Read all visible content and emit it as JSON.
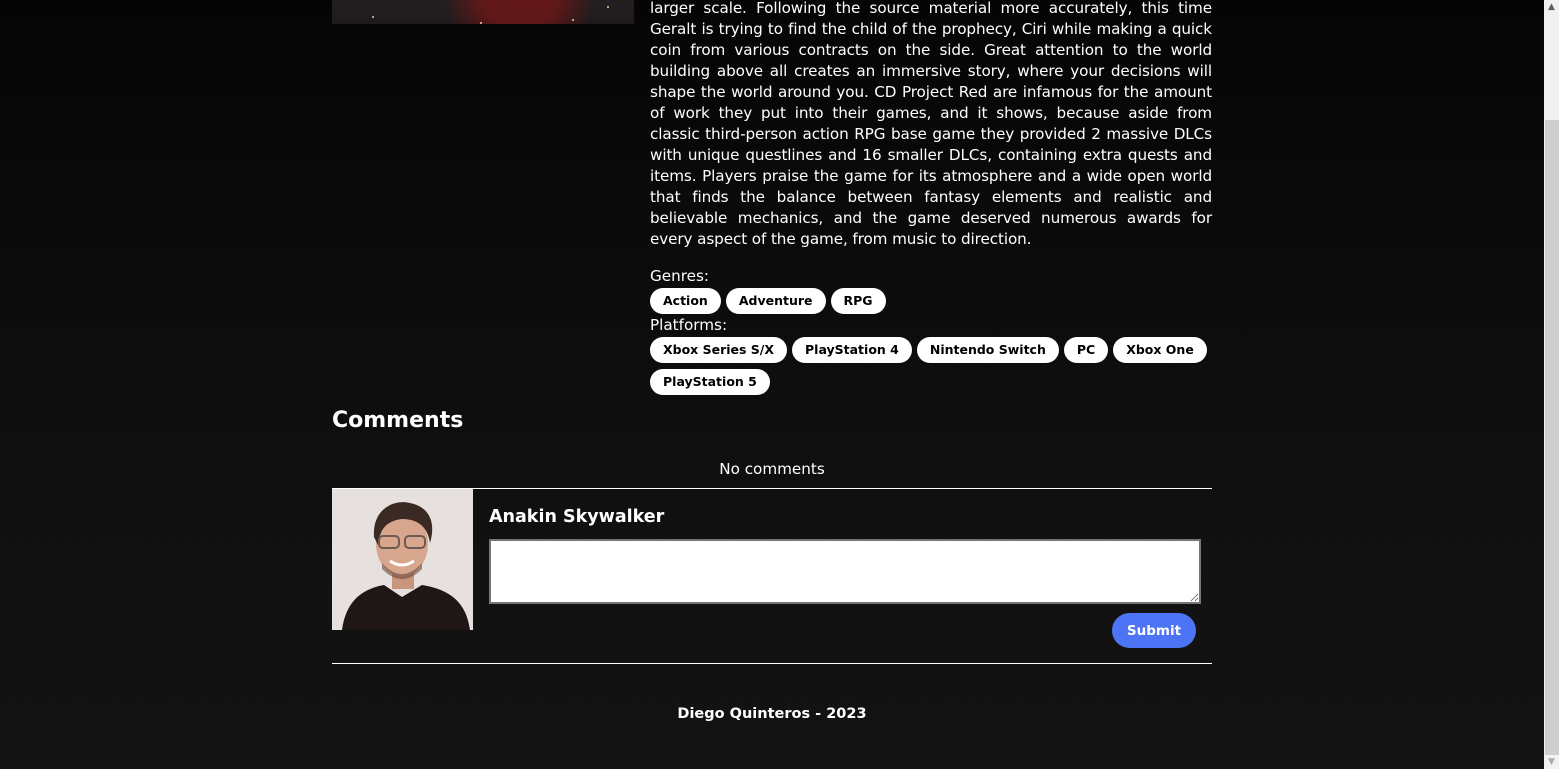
{
  "game": {
    "cover_alt": "game-cover-art",
    "description": "larger scale. Following the source material more accurately, this time Geralt is trying to find the child of the prophecy, Ciri while making a quick coin from various contracts on the side. Great attention to the world building above all creates an immersive story, where your decisions will shape the world around you. CD Project Red are infamous for the amount of work they put into their games, and it shows, because aside from classic third-person action RPG base game they provided 2 massive DLCs with unique questlines and 16 smaller DLCs, containing extra quests and items. Players praise the game for its atmosphere and a wide open world that finds the balance between fantasy elements and realistic and believable mechanics, and the game deserved numerous awards for every aspect of the game, from music to direction.",
    "genres_label": "Genres:",
    "genres": [
      "Action",
      "Adventure",
      "RPG"
    ],
    "platforms_label": "Platforms:",
    "platforms": [
      "Xbox Series S/X",
      "PlayStation 4",
      "Nintendo Switch",
      "PC",
      "Xbox One",
      "PlayStation 5"
    ]
  },
  "comments": {
    "title": "Comments",
    "empty_text": "No comments",
    "current_user": "Anakin Skywalker",
    "input_value": "",
    "input_placeholder": "",
    "submit_label": "Submit"
  },
  "footer": {
    "text": "Diego Quinteros - 2023"
  },
  "colors": {
    "accent": "#4d74f5",
    "tag_bg": "#ffffff",
    "background": "#121212"
  },
  "scrollbar": {
    "up_icon": "▲",
    "down_icon": "▼"
  }
}
